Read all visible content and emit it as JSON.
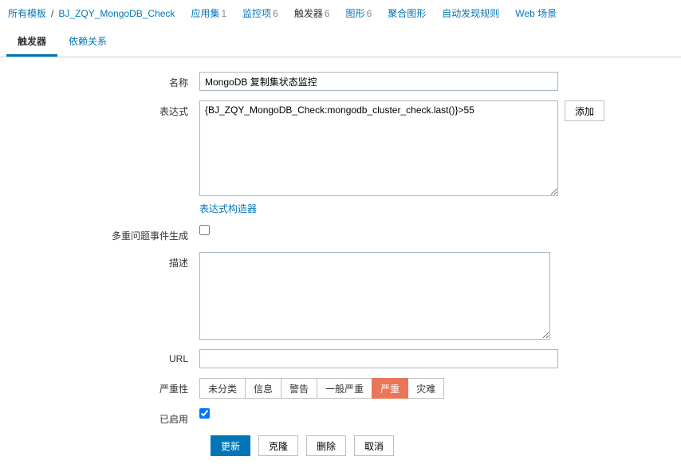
{
  "breadcrumb": {
    "all_templates": "所有模板",
    "template_name": "BJ_ZQY_MongoDB_Check",
    "items": [
      {
        "label": "应用集",
        "count": "1"
      },
      {
        "label": "监控项",
        "count": "6"
      },
      {
        "label": "触发器",
        "count": "6",
        "active": true
      },
      {
        "label": "图形",
        "count": "6"
      },
      {
        "label": "聚合图形",
        "count": ""
      },
      {
        "label": "自动发现规则",
        "count": ""
      },
      {
        "label": "Web 场景",
        "count": ""
      }
    ]
  },
  "tabs": {
    "trigger": "触发器",
    "dependencies": "依赖关系"
  },
  "form": {
    "name_label": "名称",
    "name_value": "MongoDB 复制集状态监控",
    "expr_label": "表达式",
    "expr_value": "{BJ_ZQY_MongoDB_Check:mongodb_cluster_check.last()}>55",
    "add_btn": "添加",
    "builder_link": "表达式构造器",
    "multi_label": "多重问题事件生成",
    "desc_label": "描述",
    "desc_value": "",
    "url_label": "URL",
    "url_value": "",
    "severity_label": "严重性",
    "severity": [
      "未分类",
      "信息",
      "警告",
      "一般严重",
      "严重",
      "灾难"
    ],
    "severity_selected": 4,
    "enabled_label": "已启用"
  },
  "actions": {
    "update": "更新",
    "clone": "克隆",
    "delete": "删除",
    "cancel": "取消"
  }
}
